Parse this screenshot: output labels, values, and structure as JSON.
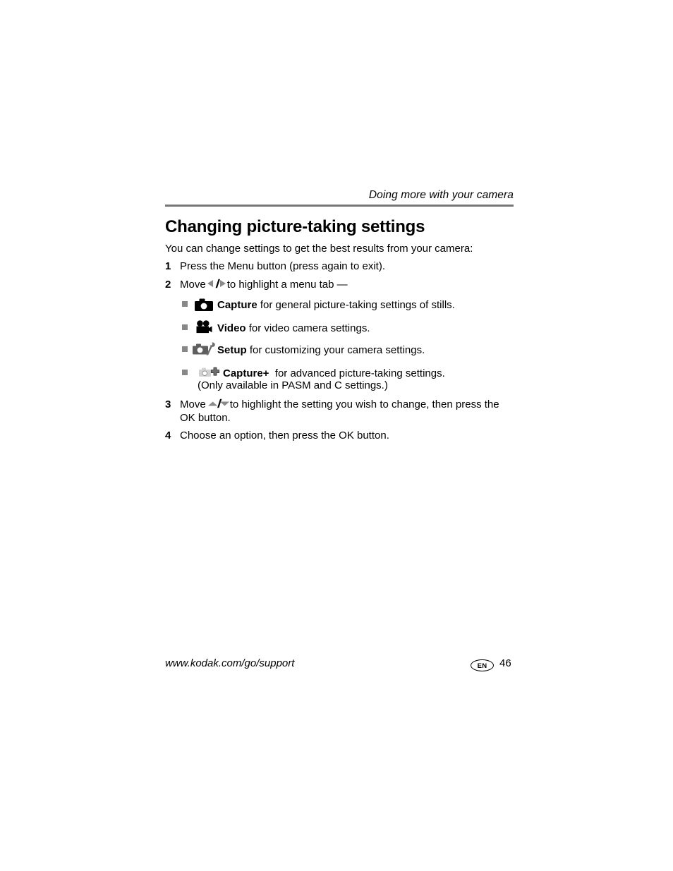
{
  "document": {
    "running_header": "Doing more with your camera",
    "title": "Changing picture-taking settings",
    "intro": "You can change settings to get the best results from your camera:"
  },
  "steps": [
    {
      "number": "1",
      "text": "Press the Menu button (press again to exit)."
    },
    {
      "number": "2",
      "text_before": "Move",
      "arrows": "left-right-arrows",
      "text_after": "to highlight a menu tab —"
    },
    {
      "number": "3",
      "text_before": "Move",
      "arrows": "up-down-arrows",
      "text_after": "to highlight the setting you wish to change, then press the OK button."
    },
    {
      "number": "4",
      "text": "Choose an option, then press the OK button."
    }
  ],
  "menu_tabs": [
    {
      "icon": "camera-icon",
      "label": "Capture",
      "description": "for general picture-taking settings of stills."
    },
    {
      "icon": "video-camera-icon",
      "label": "Video",
      "description": "for video camera settings."
    },
    {
      "icon": "camera-wrench-setup-icon",
      "label": "Setup",
      "description": "for customizing your camera settings."
    },
    {
      "icon": "camera-plus-icon",
      "label": "Capture+",
      "description": "for advanced picture-taking settings.",
      "note": "(Only available in PASM and C settings.)"
    }
  ],
  "footer": {
    "url": "www.kodak.com/go/support",
    "language_badge": "EN",
    "page_number": "46"
  },
  "colors": {
    "rule": "#767676",
    "bullet_square": "#888888",
    "icon_dark": "#000000",
    "icon_gray": "#6e6e6e",
    "icon_light_gray": "#c9c9c9",
    "text": "#000000"
  }
}
